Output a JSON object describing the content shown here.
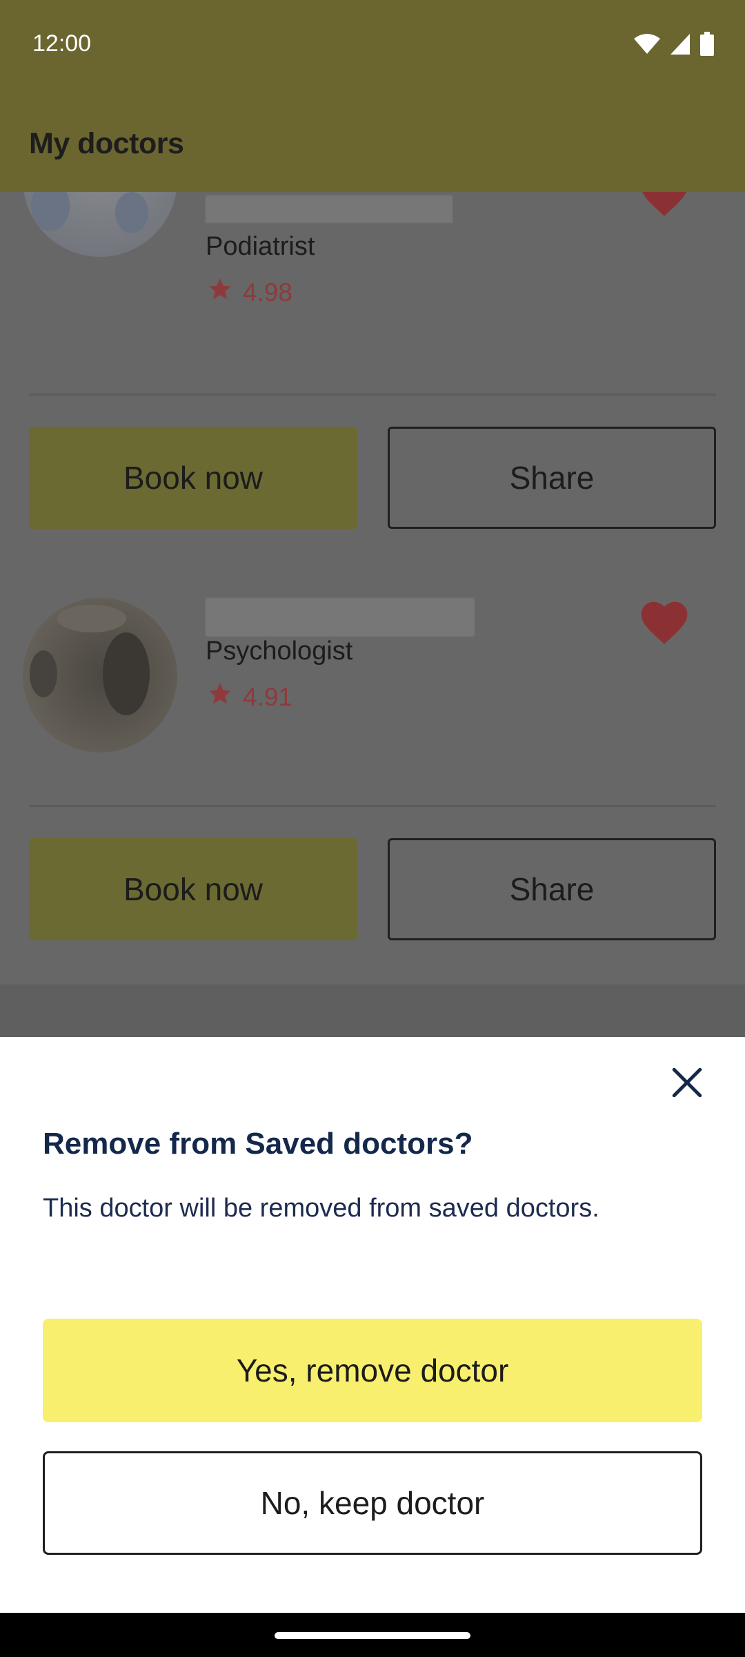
{
  "status_bar": {
    "time": "12:00",
    "icons": [
      "wifi-icon",
      "cellular-signal-icon",
      "battery-icon"
    ]
  },
  "app_bar": {
    "title": "My doctors"
  },
  "doctors": [
    {
      "specialty": "Podiatrist",
      "rating": "4.98",
      "saved": true,
      "book_label": "Book now",
      "share_label": "Share"
    },
    {
      "specialty": "Psychologist",
      "rating": "4.91",
      "saved": true,
      "book_label": "Book now",
      "share_label": "Share"
    }
  ],
  "dialog": {
    "title": "Remove from Saved doctors?",
    "body": "This doctor will be removed from saved doctors.",
    "confirm_label": "Yes, remove doctor",
    "cancel_label": "No, keep doctor",
    "close_icon": "close-icon"
  },
  "colors": {
    "accent_yellow": "#f8ef6e",
    "dialog_text": "#14284b",
    "heart_red": "#c0392b"
  }
}
